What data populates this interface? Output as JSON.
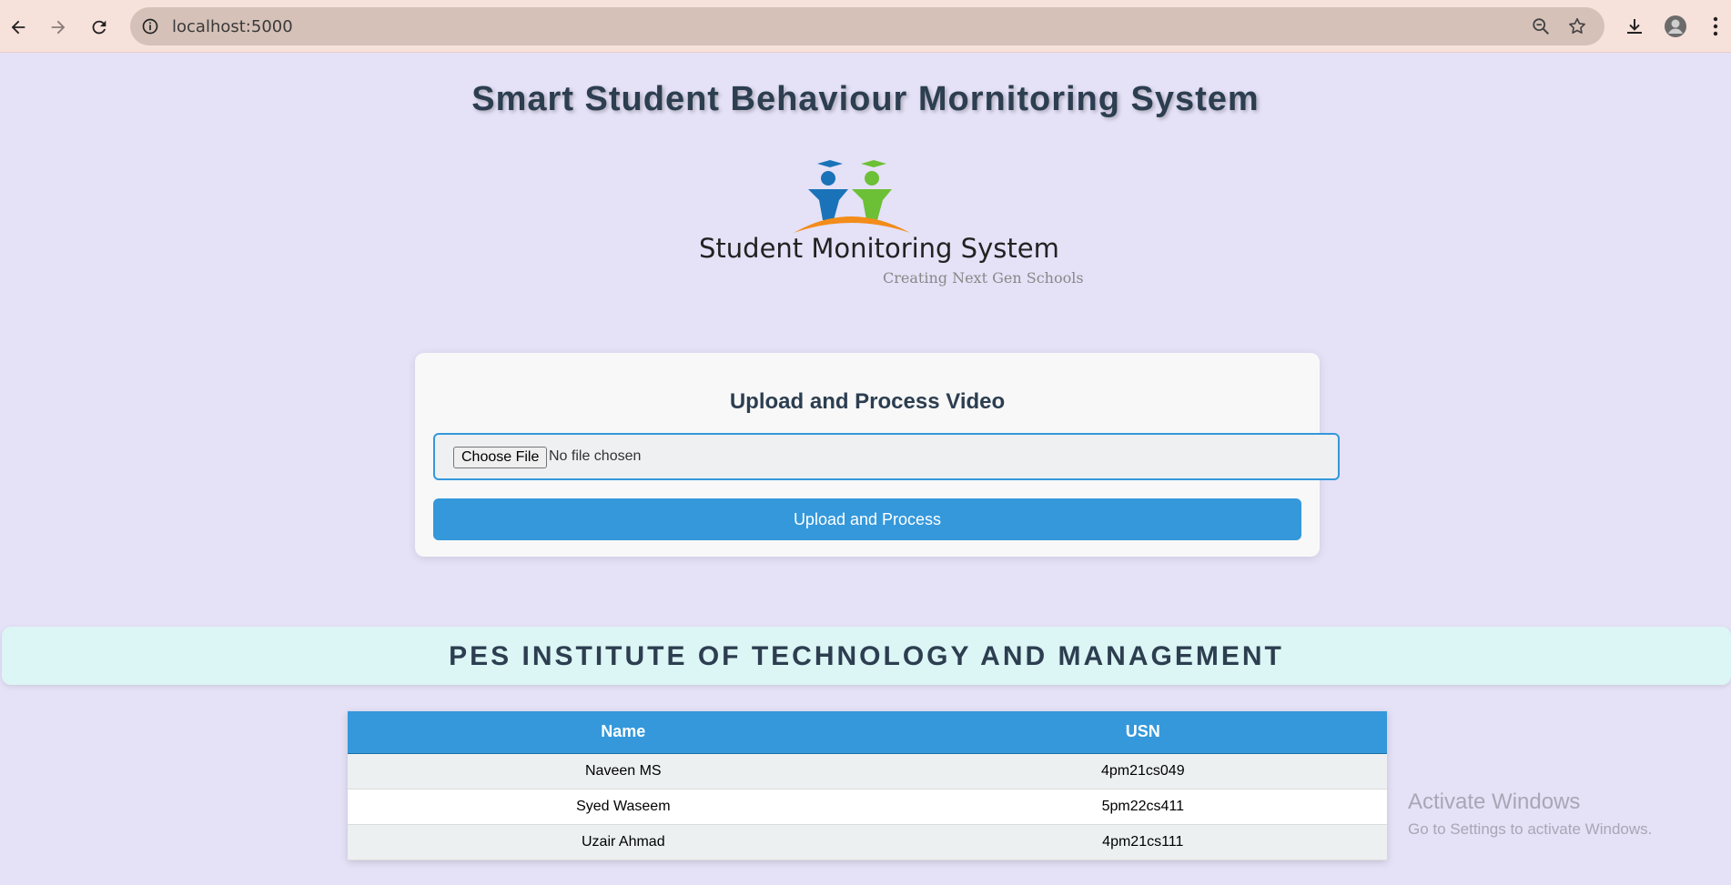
{
  "browser": {
    "url": "localhost:5000"
  },
  "page": {
    "title": "Smart Student Behaviour Mornitoring System",
    "logo": {
      "main_text": "Student Monitoring System",
      "tagline": "Creating Next Gen Schools"
    }
  },
  "upload_card": {
    "title": "Upload and Process Video",
    "choose_file_label": "Choose File",
    "file_status": "No file chosen",
    "submit_label": "Upload and Process"
  },
  "institute": {
    "name": "PES INSTITUTE OF TECHNOLOGY AND MANAGEMENT"
  },
  "students_table": {
    "headers": [
      "Name",
      "USN"
    ],
    "rows": [
      [
        "Naveen MS",
        "4pm21cs049"
      ],
      [
        "Syed Waseem",
        "5pm22cs411"
      ],
      [
        "Uzair Ahmad",
        "4pm21cs111"
      ]
    ]
  },
  "watermark": {
    "line1": "Activate Windows",
    "line2": "Go to Settings to activate Windows."
  },
  "colors": {
    "page_bg": "#e5e1f7",
    "accent": "#3498db",
    "heading": "#2c3e50",
    "chrome_bg": "#f7e1db",
    "banner_bg": "#dcf5f5"
  },
  "icons": {
    "back": "arrow-left-icon",
    "forward": "arrow-right-icon",
    "reload": "reload-icon",
    "site_info": "info-icon",
    "zoom": "zoom-out-icon",
    "bookmark": "star-icon",
    "download": "download-icon",
    "profile": "avatar",
    "menu": "kebab-menu-icon"
  }
}
